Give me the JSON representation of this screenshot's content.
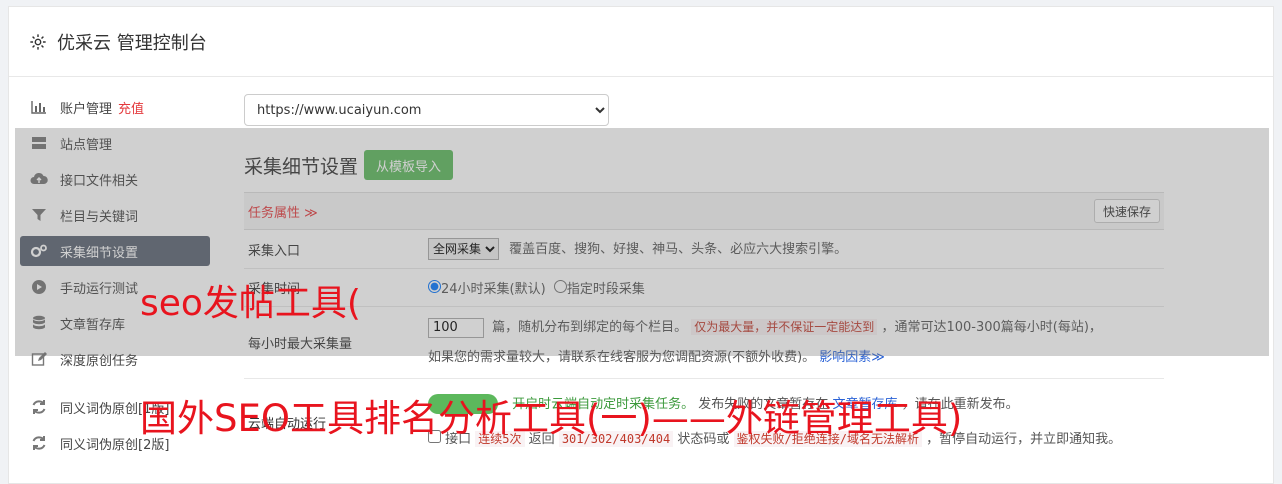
{
  "header": {
    "title": "优采云 管理控制台",
    "icon": "gear-icon"
  },
  "sidebar": {
    "items": [
      {
        "label": "账户管理",
        "extra": "充值",
        "icon": "bar-chart-icon"
      },
      {
        "label": "站点管理",
        "icon": "server-icon"
      },
      {
        "label": "接口文件相关",
        "icon": "cloud-upload-icon"
      },
      {
        "label": "栏目与关键词",
        "icon": "filter-icon"
      },
      {
        "label": "采集细节设置",
        "icon": "cogs-icon",
        "active": true
      },
      {
        "label": "手动运行测试",
        "icon": "play-circle-icon"
      },
      {
        "label": "文章暂存库",
        "icon": "database-icon"
      },
      {
        "label": "深度原创任务",
        "icon": "edit-icon"
      },
      {
        "label": "同义词伪原创[1版]",
        "icon": "refresh-icon"
      },
      {
        "label": "同义词伪原创[2版]",
        "icon": "refresh-icon"
      }
    ]
  },
  "main": {
    "site_select": "https://www.ucaiyun.com",
    "section_title": "采集细节设置",
    "import_button": "从模板导入",
    "task_attr": "任务属性 ≫",
    "quick_save": "快速保存",
    "rows": {
      "entry": {
        "label": "采集入口",
        "select": "全网采集",
        "desc": "覆盖百度、搜狗、好搜、神马、头条、必应六大搜索引擎。"
      },
      "time": {
        "label": "采集时间",
        "opt1": "24小时采集(默认)",
        "opt2": "指定时段采集"
      },
      "max": {
        "label": "每小时最大采集量",
        "value": "100",
        "text1": "篇，随机分布到绑定的每个栏目。",
        "code": "仅为最大量，并不保证一定能达到",
        "text2": "，通常可达100-300篇每小时(每站)，",
        "text3": "如果您的需求量较大，请联系在线客服为您调配资源(不额外收费)。",
        "link": "影响因素≫"
      },
      "cloud": {
        "label": "云端自动运行",
        "text_green": "开启时云端自动定时采集任务。",
        "text_dark": "发布失败的文章暂存在",
        "link": "文章暂存库",
        "text_end": "，请在此重新发布。",
        "cb_label": "接口",
        "code1": "连续5次",
        "t1": "返回",
        "code2": "301/302/403/404",
        "t2": "状态码或",
        "code3": "鉴权失败/拒绝连接/域名无法解析",
        "t3": "，暂停自动运行，并立即通知我。"
      }
    }
  },
  "watermark": {
    "line1": "seo发帖工具(",
    "line2": "国外SEO工具排名分析工具(一)——外链管理工具)"
  }
}
